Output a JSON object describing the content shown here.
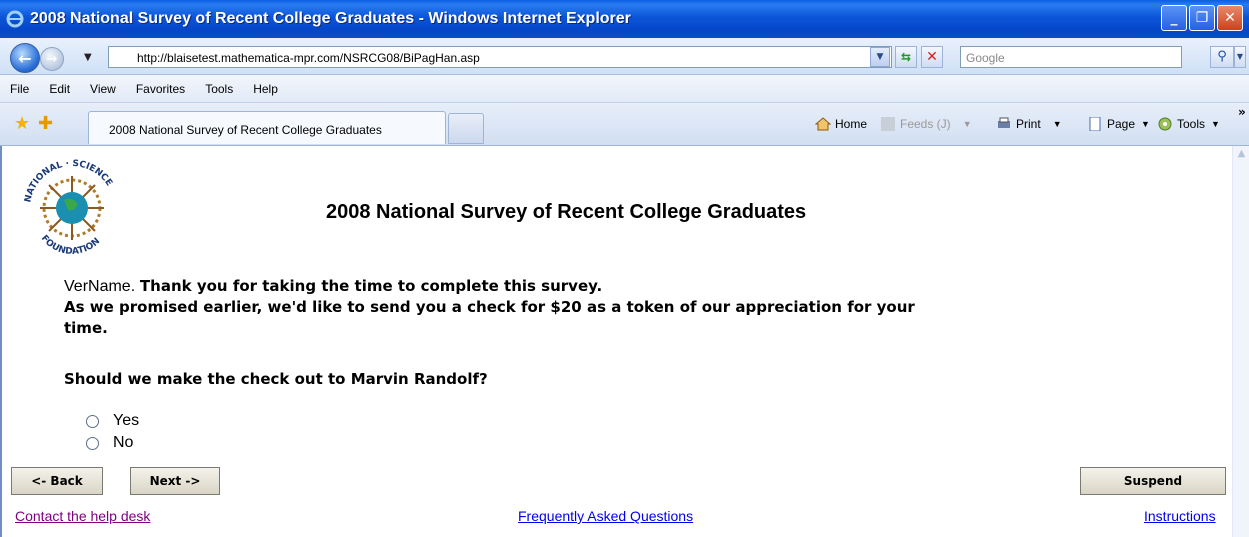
{
  "window": {
    "title": "2008 National Survey of Recent College Graduates - Windows Internet Explorer",
    "minimize": "_",
    "maximize": "❐",
    "close": "✕"
  },
  "addressbar": {
    "url": "http://blaisetest.mathematica-mpr.com/NSRCG08/BiPagHan.asp",
    "search_placeholder": "Google"
  },
  "menu": [
    "File",
    "Edit",
    "View",
    "Favorites",
    "Tools",
    "Help"
  ],
  "tabs": {
    "active_label": "2008 National Survey of Recent College Graduates"
  },
  "commands": {
    "home": "Home",
    "feeds": "Feeds (J)",
    "print": "Print",
    "page": "Page",
    "tools": "Tools"
  },
  "page": {
    "title": "2008 National Survey of Recent College Graduates",
    "logo_text_top": "NATIONAL · SCIENCE",
    "logo_text_bottom": "FOUNDATION",
    "varname": "VerName.",
    "intro_line1": "Thank you for taking the time to complete this survey.",
    "intro_line2": "As we promised earlier, we'd like to send you a check for $20 as a token of our appreciation for your time.",
    "question": "Should we make the check out to Marvin Randolf?",
    "options": [
      "Yes",
      "No"
    ]
  },
  "buttons": {
    "back": "<- Back",
    "next": "Next ->",
    "suspend": "Suspend"
  },
  "links": {
    "help": "Contact the help desk",
    "faq": "Frequently Asked Questions",
    "instructions": "Instructions"
  },
  "colors": {
    "titlebar": "#0b55d8",
    "link": "#0000ee",
    "visited_link": "#800080"
  }
}
